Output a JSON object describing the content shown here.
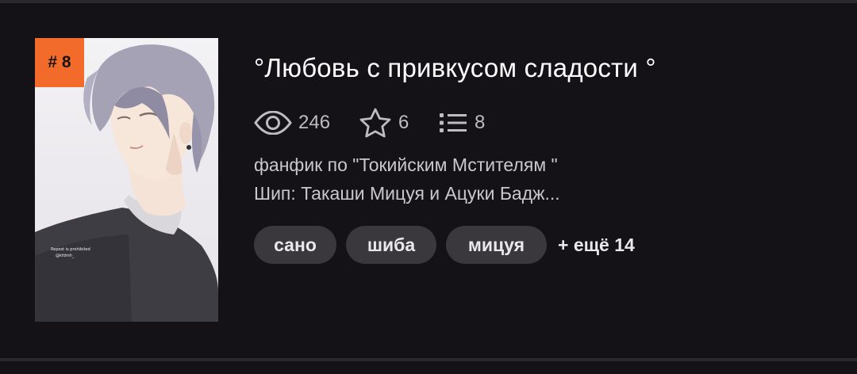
{
  "work": {
    "rank_label": "# 8",
    "title": "°Любовь с привкусом сладости °",
    "stats": {
      "views": "246",
      "likes": "6",
      "chapters": "8"
    },
    "description_lines": [
      "фанфик по \"Токийским Мстителям \"",
      "Шип: Такаши Мицуя и Ацуки Бадж..."
    ],
    "tags": [
      "сано",
      "шиба",
      "мицуя"
    ],
    "more_tags_label": "+ ещё 14"
  },
  "colors": {
    "background": "#141217",
    "rank_badge": "#f26b2a",
    "tag_bg": "#3a383d",
    "text_secondary": "#bdbcc2"
  },
  "icons": {
    "views": "eye-icon",
    "likes": "star-icon",
    "chapters": "list-icon"
  }
}
